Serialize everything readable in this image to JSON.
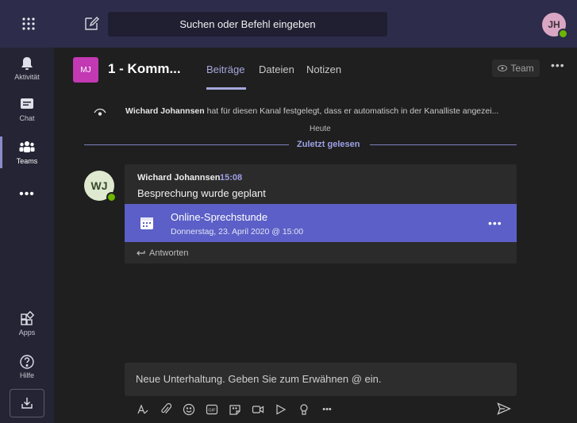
{
  "titlebar": {
    "search_placeholder": "Suchen oder Befehl eingeben",
    "user_initials": "JH"
  },
  "rail": {
    "items": [
      {
        "label": "Aktivität",
        "icon": "bell-icon"
      },
      {
        "label": "Chat",
        "icon": "chat-icon"
      },
      {
        "label": "Teams",
        "icon": "teams-icon",
        "active": true
      },
      {
        "label": "Apps",
        "icon": "apps-icon"
      },
      {
        "label": "Hilfe",
        "icon": "help-icon"
      }
    ],
    "more_label": "•••"
  },
  "channel": {
    "team_initials": "MJ",
    "name": "1 - Komm...",
    "tabs": [
      "Beiträge",
      "Dateien",
      "Notizen"
    ],
    "active_tab": "Beiträge",
    "team_button": "Team",
    "more": "•••"
  },
  "feed": {
    "system_author": "Wichard Johannsen",
    "system_text": " hat für diesen Kanal festgelegt, dass er automatisch in der Kanalliste angezei...",
    "divider_today": "Heute",
    "divider_last_read": "Zuletzt gelesen",
    "post": {
      "avatar_initials": "WJ",
      "author": "Wichard Johannsen",
      "time": "15:08",
      "text": "Besprechung wurde geplant",
      "meeting_title": "Online-Sprechstunde",
      "meeting_date": "Donnerstag, 23. April 2020 @ 15:00",
      "meeting_more": "•••",
      "reply_label": "Antworten"
    }
  },
  "composer": {
    "placeholder": "Neue Unterhaltung. Geben Sie zum Erwähnen @ ein.",
    "toolbar_icons": [
      "format-icon",
      "attach-icon",
      "emoji-icon",
      "gif-icon",
      "sticker-icon",
      "meet-now-icon",
      "stream-icon",
      "praise-icon",
      "more-icon"
    ],
    "gif_label": "GIF",
    "more_label": "•••"
  },
  "colors": {
    "accent": "#5b5fc7",
    "accent_text": "#9ea0e6",
    "titlebar": "#2d2c4a",
    "rail": "#252434",
    "presence": "#6bb700",
    "team_tile": "#c239b3"
  }
}
